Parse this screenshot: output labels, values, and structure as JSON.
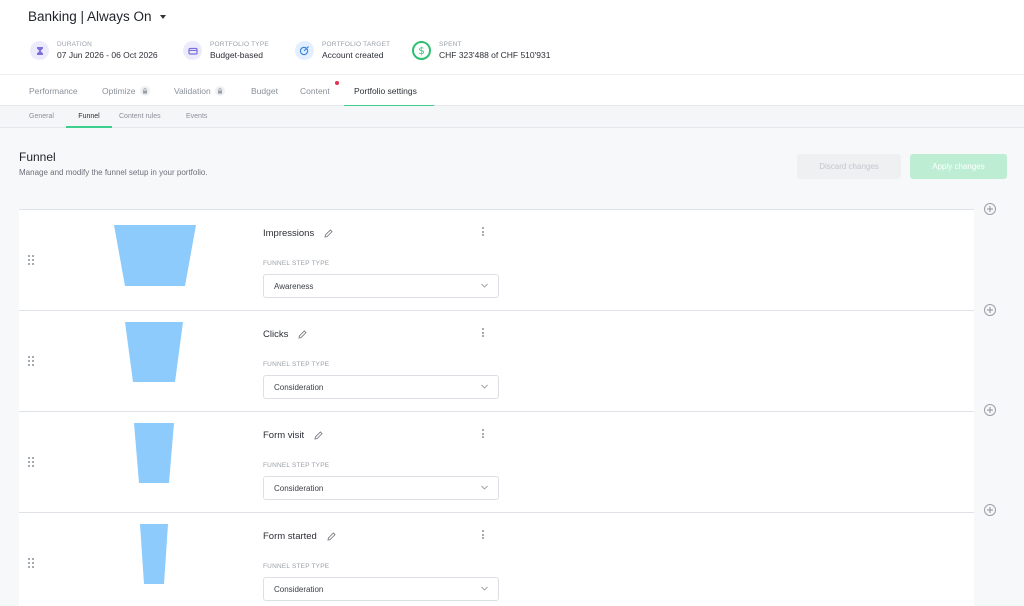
{
  "header": {
    "title": "Banking | Always On",
    "meta": [
      {
        "label": "DURATION",
        "value": "07 Jun 2026 - 06 Oct 2026",
        "icon": "hourglass-icon",
        "color": "#7b6ee0"
      },
      {
        "label": "PORTFOLIO TYPE",
        "value": "Budget-based",
        "icon": "wallet-icon",
        "color": "#7b6ee0"
      },
      {
        "label": "PORTFOLIO TARGET",
        "value": "Account created",
        "icon": "target-icon",
        "color": "#3a8be0"
      },
      {
        "label": "SPENT",
        "value": "CHF 323'488 of CHF 510'931",
        "icon": "dollar-icon",
        "color": "#2fbf71"
      }
    ]
  },
  "tabs": {
    "items": [
      {
        "label": "Performance"
      },
      {
        "label": "Optimize",
        "locked": true
      },
      {
        "label": "Validation",
        "locked": true
      },
      {
        "label": "Budget"
      },
      {
        "label": "Content",
        "notification": true
      },
      {
        "label": "Portfolio settings",
        "active": true
      }
    ]
  },
  "subtabs": {
    "items": [
      {
        "label": "General"
      },
      {
        "label": "Funnel",
        "active": true
      },
      {
        "label": "Content rules"
      },
      {
        "label": "Events"
      }
    ]
  },
  "main": {
    "title": "Funnel",
    "subtitle": "Manage and modify the funnel setup in your portfolio.",
    "discard_label": "Discard changes",
    "apply_label": "Apply changes"
  },
  "funnel": {
    "type_label": "FUNNEL STEP TYPE",
    "shape_color": "#8ccbfb",
    "accent_color": "#3ccf8e",
    "steps": [
      {
        "name": "Impressions",
        "type": "Awareness"
      },
      {
        "name": "Clicks",
        "type": "Consideration"
      },
      {
        "name": "Form visit",
        "type": "Consideration"
      },
      {
        "name": "Form started",
        "type": "Consideration"
      }
    ]
  }
}
